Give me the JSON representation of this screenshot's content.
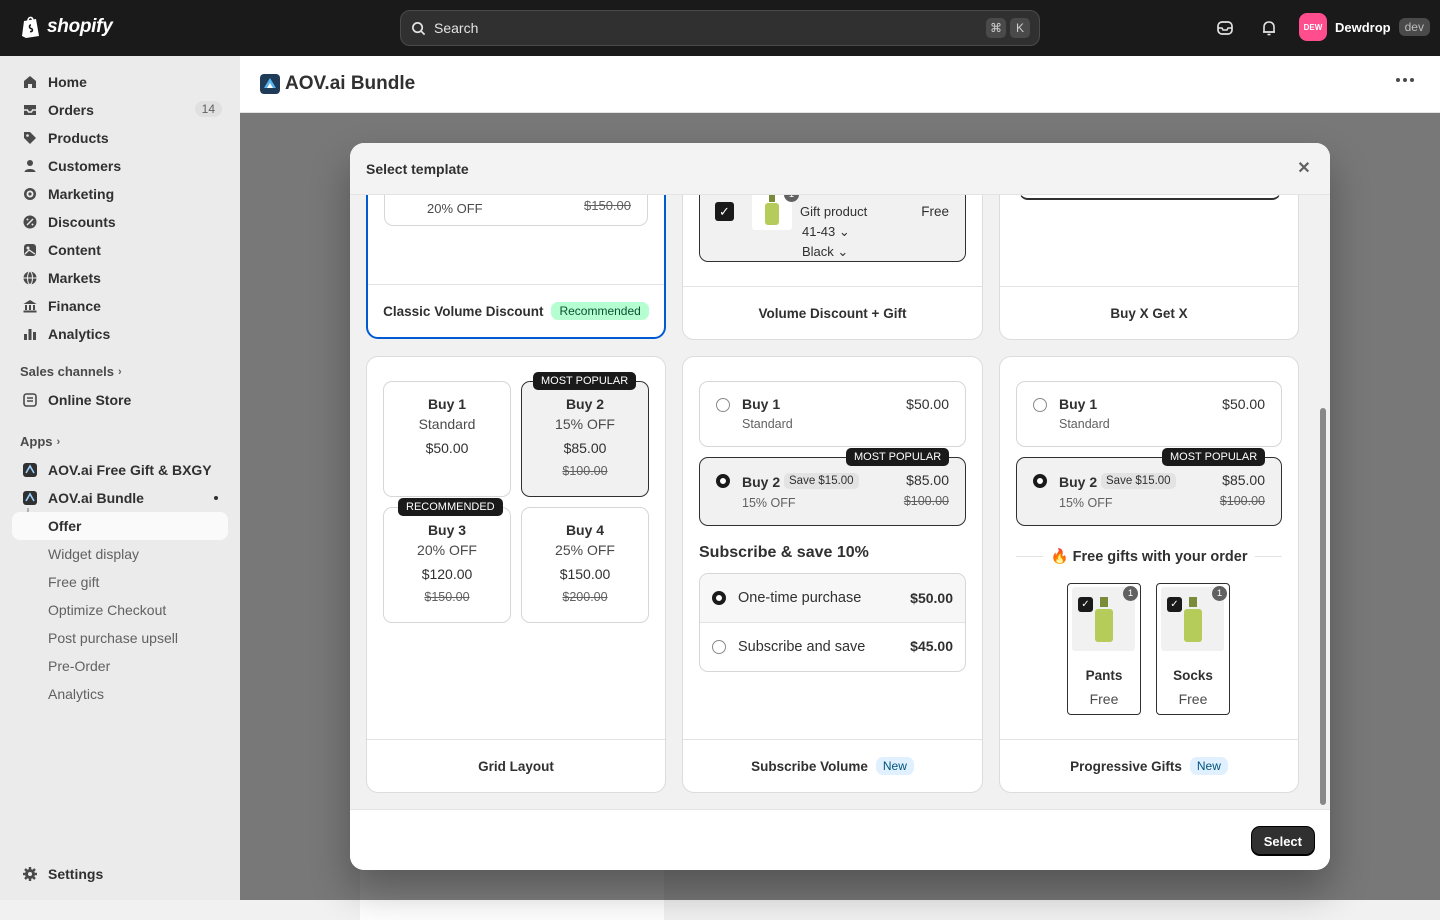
{
  "topbar": {
    "logo_text": "shopify",
    "search_placeholder": "Search",
    "shortcut_cmd": "⌘",
    "shortcut_key": "K",
    "store_initials": "DEW",
    "store_name": "Dewdrop",
    "store_tag": "dev"
  },
  "sidebar": {
    "items": [
      {
        "label": "Home",
        "icon": "home-icon"
      },
      {
        "label": "Orders",
        "icon": "orders-icon",
        "count": "14"
      },
      {
        "label": "Products",
        "icon": "tag-icon"
      },
      {
        "label": "Customers",
        "icon": "person-icon"
      },
      {
        "label": "Marketing",
        "icon": "target-icon"
      },
      {
        "label": "Discounts",
        "icon": "discount-icon"
      },
      {
        "label": "Content",
        "icon": "content-icon"
      },
      {
        "label": "Markets",
        "icon": "globe-icon"
      },
      {
        "label": "Finance",
        "icon": "bank-icon"
      },
      {
        "label": "Analytics",
        "icon": "chart-icon"
      }
    ],
    "sales_channels_label": "Sales channels",
    "online_store_label": "Online Store",
    "apps_label": "Apps",
    "app1_label": "AOV.ai Free Gift & BXGY",
    "app2_label": "AOV.ai Bundle",
    "sub_items": [
      "Offer",
      "Widget display",
      "Free gift",
      "Optimize Checkout",
      "Post purchase upsell",
      "Pre-Order",
      "Analytics"
    ],
    "settings_label": "Settings"
  },
  "app_header": {
    "title": "AOV.ai Bundle"
  },
  "modal": {
    "title": "Select template",
    "select_label": "Select",
    "top_cards": {
      "classic": {
        "partial_sub": "20% OFF",
        "partial_old": "$150.00",
        "name": "Classic Volume Discount",
        "badge": "Recommended"
      },
      "gift": {
        "gift_title": "Gift product",
        "gift_price": "Free",
        "size": "41-43",
        "color": "Black",
        "gift_qty": "1",
        "name": "Volume Discount + Gift"
      },
      "bxgx": {
        "name": "Buy X Get X"
      }
    },
    "grid_card": {
      "name": "Grid Layout",
      "boxes": [
        {
          "title": "Buy 1",
          "sub": "Standard",
          "price": "$50.00",
          "old": ""
        },
        {
          "title": "Buy 2",
          "sub": "15% OFF",
          "price": "$85.00",
          "old": "$100.00",
          "tag": "MOST POPULAR"
        },
        {
          "title": "Buy 3",
          "sub": "20% OFF",
          "price": "$120.00",
          "old": "$150.00",
          "tag": "RECOMMENDED"
        },
        {
          "title": "Buy 4",
          "sub": "25% OFF",
          "price": "$150.00",
          "old": "$200.00"
        }
      ]
    },
    "subscribe_card": {
      "name": "Subscribe Volume",
      "badge": "New",
      "opt1": {
        "title": "Buy 1",
        "sub": "Standard",
        "price": "$50.00"
      },
      "opt2": {
        "title": "Buy 2",
        "save": "Save $15.00",
        "sub": "15% OFF",
        "price": "$85.00",
        "old": "$100.00",
        "tag": "MOST POPULAR"
      },
      "subscribe_heading": "Subscribe & save 10%",
      "one_time_label": "One-time purchase",
      "one_time_price": "$50.00",
      "subscribe_label": "Subscribe and save",
      "subscribe_price": "$45.00"
    },
    "progressive_card": {
      "name": "Progressive Gifts",
      "badge": "New",
      "opt1": {
        "title": "Buy 1",
        "sub": "Standard",
        "price": "$50.00"
      },
      "opt2": {
        "title": "Buy 2",
        "save": "Save $15.00",
        "sub": "15% OFF",
        "price": "$85.00",
        "old": "$100.00",
        "tag": "MOST POPULAR"
      },
      "gifts_heading": "🔥 Free gifts with your order",
      "gifts": [
        {
          "name": "Pants",
          "price": "Free",
          "qty": "1"
        },
        {
          "name": "Socks",
          "price": "Free",
          "qty": "1"
        }
      ]
    }
  },
  "colors": {
    "accent_selected": "#005bd3",
    "recommended_bg": "#b4fed2",
    "new_bg": "#e0f0ff",
    "avatar_bg": "#ff4d8d"
  }
}
